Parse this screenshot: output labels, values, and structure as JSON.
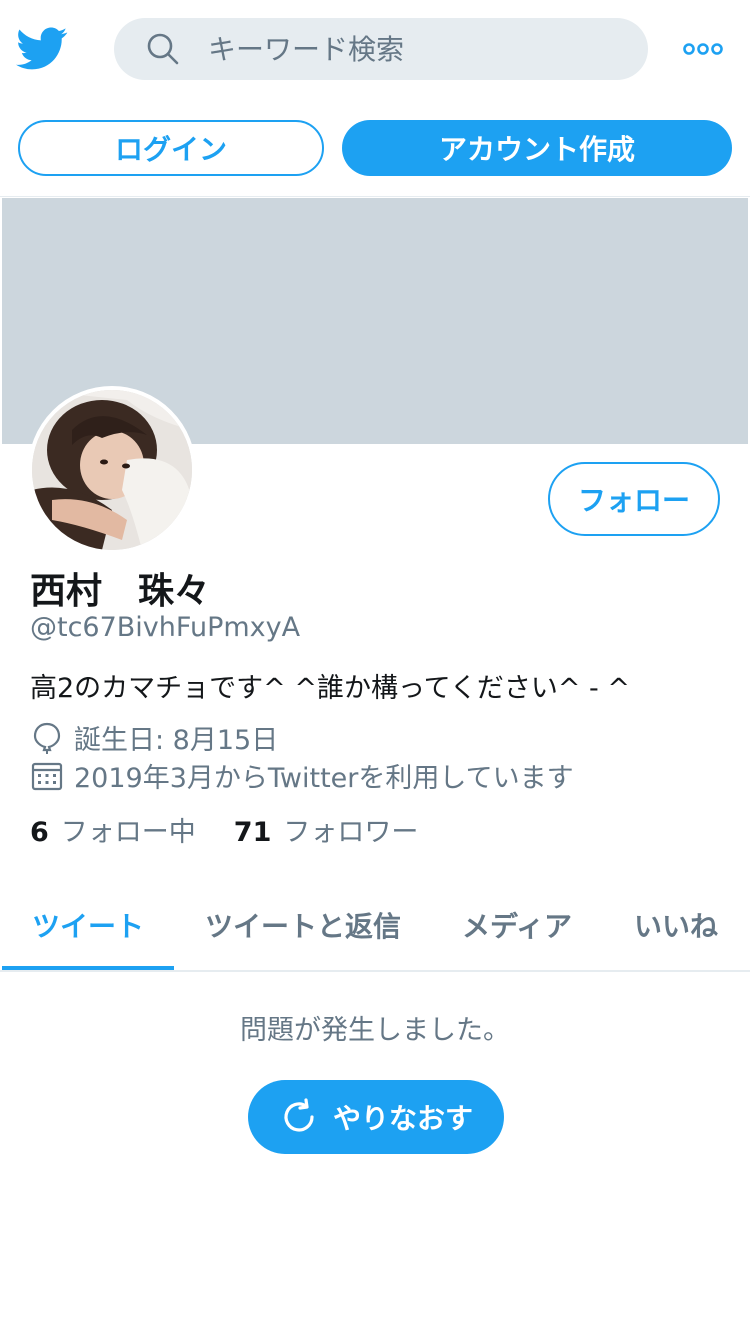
{
  "header": {
    "search_placeholder": "キーワード検索",
    "login_label": "ログイン",
    "signup_label": "アカウント作成"
  },
  "profile": {
    "name": "西村　珠々",
    "handle": "@tc67BivhFuPmxyA",
    "bio": "高2のカマチョです^ ^誰か構ってください^ - ^",
    "birthday": "誕生日: 8月15日",
    "joined": "2019年3月からTwitterを利用しています",
    "following_count": "6",
    "following_label": "フォロー中",
    "followers_count": "71",
    "followers_label": "フォロワー",
    "follow_button": "フォロー"
  },
  "tabs": [
    {
      "label": "ツイート",
      "active": true
    },
    {
      "label": "ツイートと返信",
      "active": false
    },
    {
      "label": "メディア",
      "active": false
    },
    {
      "label": "いいね",
      "active": false
    }
  ],
  "content": {
    "error_message": "問題が発生しました。",
    "retry_label": "やりなおす"
  },
  "colors": {
    "accent": "#1da1f2",
    "banner": "#ccd6dd",
    "secondary_text": "#657786"
  },
  "icons": [
    "twitter-bird-icon",
    "search-icon",
    "more-icon",
    "balloon-icon",
    "calendar-icon",
    "refresh-icon"
  ]
}
